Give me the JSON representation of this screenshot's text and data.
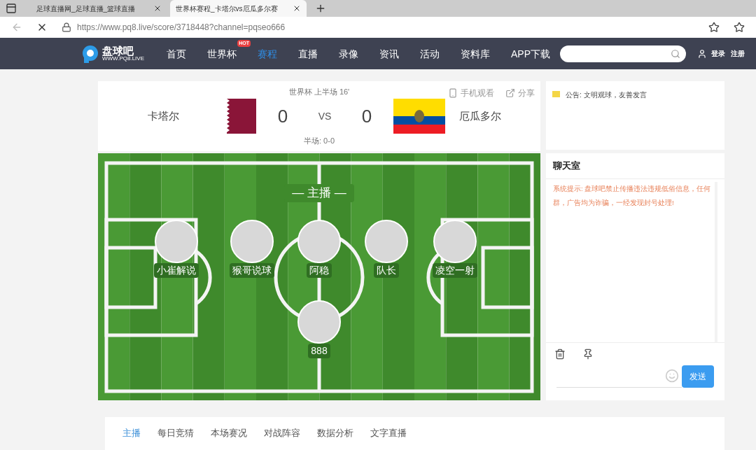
{
  "browser": {
    "tabs": [
      {
        "title": "足球直播网_足球直播_篮球直播",
        "selected": false
      },
      {
        "title": "世界杯赛程_卡塔尔vs厄瓜多尔赛",
        "selected": true
      }
    ],
    "url": "https://www.pq8.live/score/3718448?channel=pqseo666"
  },
  "site": {
    "logo": "盘球吧",
    "logo_sub": "WWW.PQ8.LIVE",
    "nav": [
      {
        "label": "首页",
        "selected": false
      },
      {
        "label": "世界杯",
        "selected": false,
        "badge": "HOT"
      },
      {
        "label": "赛程",
        "selected": true
      },
      {
        "label": "直播",
        "selected": false
      },
      {
        "label": "录像",
        "selected": false
      },
      {
        "label": "资讯",
        "selected": false
      },
      {
        "label": "活动",
        "selected": false
      },
      {
        "label": "资料库",
        "selected": false
      },
      {
        "label": "APP下载",
        "selected": false
      }
    ],
    "login": "登录",
    "register": "注册"
  },
  "match": {
    "status": "世界杯 上半场 16'",
    "home": "卡塔尔",
    "away": "厄瓜多尔",
    "home_score": "0",
    "away_score": "0",
    "vs": "VS",
    "halftime": "半场: 0-0",
    "mobile": "手机观看",
    "share": "分享"
  },
  "stage": {
    "title": "— 主播 —",
    "hosts": [
      {
        "name": "小崔解说"
      },
      {
        "name": "猴哥说球"
      },
      {
        "name": "阿稳"
      },
      {
        "name": "队长"
      },
      {
        "name": "凌空一射"
      },
      {
        "name": "888"
      }
    ]
  },
  "notice": "公告: 文明观球，友善发言",
  "chat": {
    "title": "聊天室",
    "system_label": "系统提示:",
    "system_text": "盘球吧禁止传播违法违规低俗信息，任何群，广告均为诈骗，一经发现封号处理!",
    "send": "发送"
  },
  "tabs": [
    {
      "label": "主播",
      "selected": true
    },
    {
      "label": "每日竞猜",
      "selected": false
    },
    {
      "label": "本场赛况",
      "selected": false
    },
    {
      "label": "对战阵容",
      "selected": false
    },
    {
      "label": "数据分析",
      "selected": false
    },
    {
      "label": "文字直播",
      "selected": false
    }
  ]
}
